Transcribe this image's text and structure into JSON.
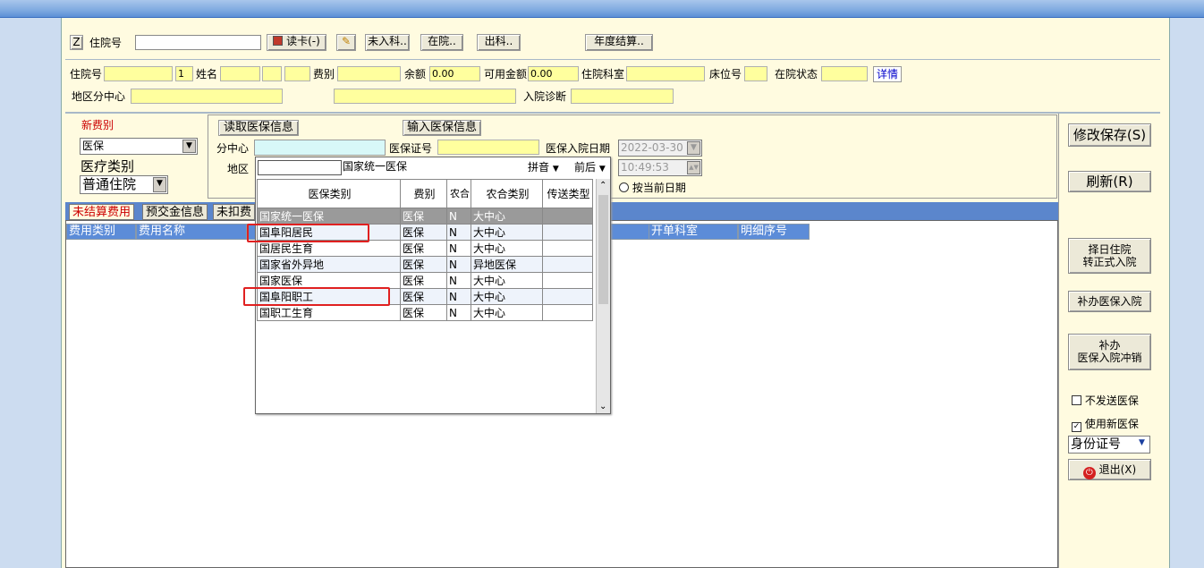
{
  "toolbar": {
    "z_label": "Z",
    "inpatient_no_label": "住院号",
    "read_card": "读卡(-)",
    "not_admitted": "未入科..",
    "in_hospital": "在院..",
    "discharged": "出科..",
    "annual_settle": "年度结算.."
  },
  "patient": {
    "inpatient_no_label": "住院号",
    "visit_count": "1",
    "name_label": "姓名",
    "fee_type_label": "费别",
    "balance_label": "余额",
    "balance_value": "0.00",
    "available_label": "可用金额",
    "available_value": "0.00",
    "dept_label": "住院科室",
    "bed_label": "床位号",
    "status_label": "在院状态",
    "detail_link": "详情",
    "region_label": "地区分中心",
    "diagnosis_label": "入院诊断"
  },
  "fee_panel": {
    "new_fee_label": "新费别",
    "new_fee_value": "医保",
    "med_type_label": "医疗类别",
    "med_type_value": "普通住院"
  },
  "insurance": {
    "read_info": "读取医保信息",
    "input_info": "输入医保信息",
    "subcenter_label": "分中心",
    "card_no_label": "医保证号",
    "admit_date_label": "医保入院日期",
    "admit_date_value": "2022-03-30",
    "region_label": "地区",
    "region_search_value": "",
    "region_current_value": "国家统一医保",
    "admit_time_value": "10:49:53",
    "search_mode": "拼音",
    "match_mode": "前后",
    "current_date_option": "按当前日期"
  },
  "tabs": [
    "未结算费用",
    "预交金信息",
    "未扣费"
  ],
  "grid_headers_left": [
    "费用类别",
    "费用名称"
  ],
  "grid_headers_right": [
    "开单科室",
    "明细序号"
  ],
  "dropdown": {
    "headers": [
      "医保类别",
      "费别",
      "农合",
      "农合类别",
      "传送类型"
    ],
    "rows": [
      [
        "国家统一医保",
        "医保",
        "N",
        "大中心",
        ""
      ],
      [
        "国阜阳居民",
        "医保",
        "N",
        "大中心",
        ""
      ],
      [
        "国居民生育",
        "医保",
        "N",
        "大中心",
        ""
      ],
      [
        "国家省外异地",
        "医保",
        "N",
        "异地医保",
        ""
      ],
      [
        "国家医保",
        "医保",
        "N",
        "大中心",
        ""
      ],
      [
        "国阜阳职工",
        "医保",
        "N",
        "大中心",
        ""
      ],
      [
        "国职工生育",
        "医保",
        "N",
        "大中心",
        ""
      ]
    ]
  },
  "right_panel": {
    "save": "修改保存(S)",
    "refresh": "刷新(R)",
    "select_date_l1": "择日住院",
    "select_date_l2": "转正式入院",
    "supp_admit": "补办医保入院",
    "supp_cancel_l1": "补办",
    "supp_cancel_l2": "医保入院冲销",
    "no_send": "不发送医保",
    "use_new": "使用新医保",
    "id_type": "身份证号",
    "exit": "退出(X)"
  },
  "colors": {
    "accent_blue": "#5b86cc",
    "selected_row": "#9a9a9a",
    "highlight": "#e02020",
    "field_yellow": "#ffff9e"
  }
}
